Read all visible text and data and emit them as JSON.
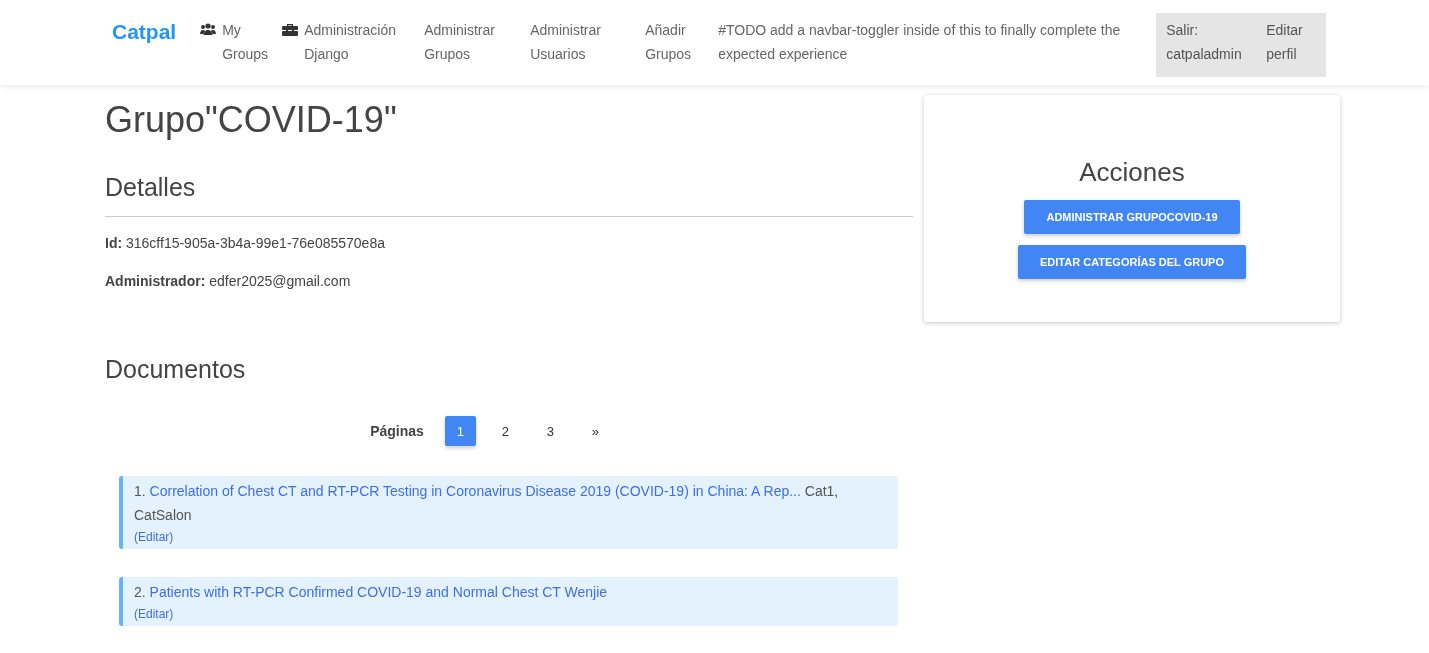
{
  "navbar": {
    "brand": "Catpal",
    "links": [
      {
        "label": "My Groups",
        "kind": "group"
      },
      {
        "label": "Administración Django",
        "kind": "admin"
      },
      {
        "label": "Administrar Grupos",
        "kind": "plain"
      },
      {
        "label": "Administrar Usuarios",
        "kind": "plain"
      },
      {
        "label": "Añadir Grupos",
        "kind": "plain"
      }
    ],
    "note": "#TODO add a navbar-toggler inside of this to finally complete the expected experience",
    "user_links": [
      "Salir: catpaladmin",
      "Editar perfil"
    ]
  },
  "title": "Grupo\"COVID-19\"",
  "details": {
    "heading": "Detalles",
    "fields": [
      {
        "label": "Id:",
        "value": "316cff15-905a-3b4a-99e1-76e085570e8a"
      },
      {
        "label": "Administrador:",
        "value": "edfer2025@gmail.com"
      }
    ]
  },
  "actions": {
    "heading": "Acciones",
    "buttons": [
      "ADMINISTRAR GRUPOCOVID-19",
      "EDITAR CATEGORÍAS DEL GRUPO"
    ]
  },
  "documents": {
    "heading": "Documentos",
    "pagination": {
      "label": "Páginas",
      "pages": [
        {
          "label": "1",
          "selected": true
        },
        {
          "label": "2",
          "selected": false
        },
        {
          "label": "3",
          "selected": false
        },
        {
          "label": "»",
          "selected": false
        }
      ]
    },
    "items": [
      {
        "number": "1.",
        "title": "Correlation of Chest CT and RT-PCR Testing in Coronavirus Disease 2019 (COVID-19) in China: A Rep...",
        "categories": "Cat1, CatSalon",
        "edit": "(Editar)"
      },
      {
        "number": "2.",
        "title": "Patients with RT-PCR Confirmed COVID-19 and Normal Chest CT Wenjie",
        "edit": "(Editar)"
      }
    ]
  }
}
